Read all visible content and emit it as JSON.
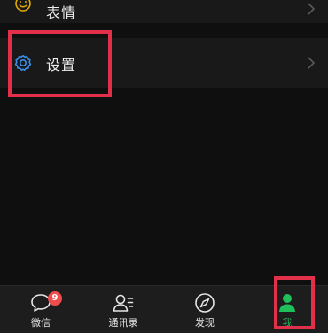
{
  "menu": {
    "items": [
      {
        "label": "表情",
        "icon": "smiley-icon"
      },
      {
        "label": "设置",
        "icon": "gear-icon"
      }
    ]
  },
  "tabbar": {
    "tabs": [
      {
        "label": "微信",
        "icon": "chat-bubble-icon",
        "badge": "9"
      },
      {
        "label": "通讯录",
        "icon": "contacts-icon"
      },
      {
        "label": "发现",
        "icon": "compass-icon"
      },
      {
        "label": "我",
        "icon": "person-icon",
        "active": true
      }
    ]
  },
  "colors": {
    "accent": "#1fbf5c",
    "highlight": "#e2304a",
    "badge": "#f14c4c",
    "gear": "#3a8ee6",
    "smiley": "#e0a800"
  }
}
